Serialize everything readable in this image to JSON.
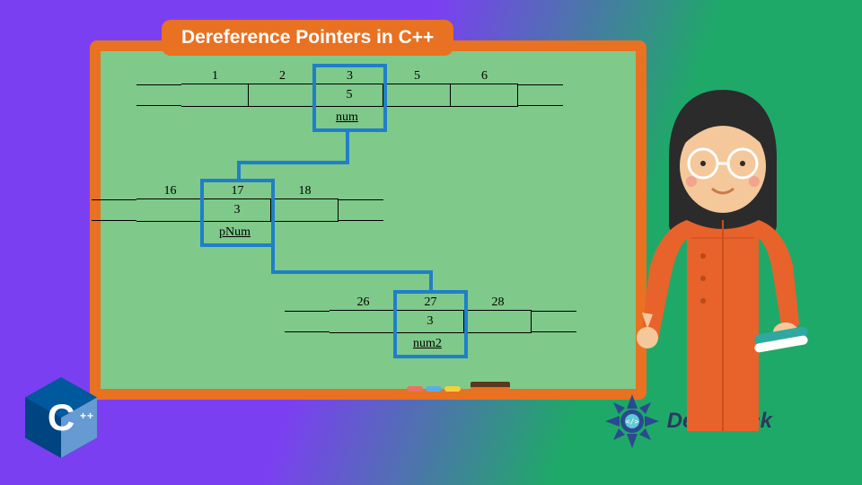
{
  "title": "Dereference Pointers in C++",
  "row1": {
    "addrs": [
      "1",
      "2",
      "3",
      "5",
      "6"
    ],
    "highlighted_value": "5",
    "var_name": "num"
  },
  "row2": {
    "addrs": [
      "16",
      "17",
      "18"
    ],
    "highlighted_value": "3",
    "var_name": "pNum"
  },
  "row3": {
    "addrs": [
      "26",
      "27",
      "28"
    ],
    "highlighted_value": "3",
    "var_name": "num2"
  },
  "logos": {
    "cpp": "C",
    "cpp_plus": "++",
    "delftstack": "DelftStack"
  },
  "colors": {
    "highlight": "#1f7fc9",
    "board_frame": "#e87122",
    "board_bg": "#7fc98a"
  }
}
